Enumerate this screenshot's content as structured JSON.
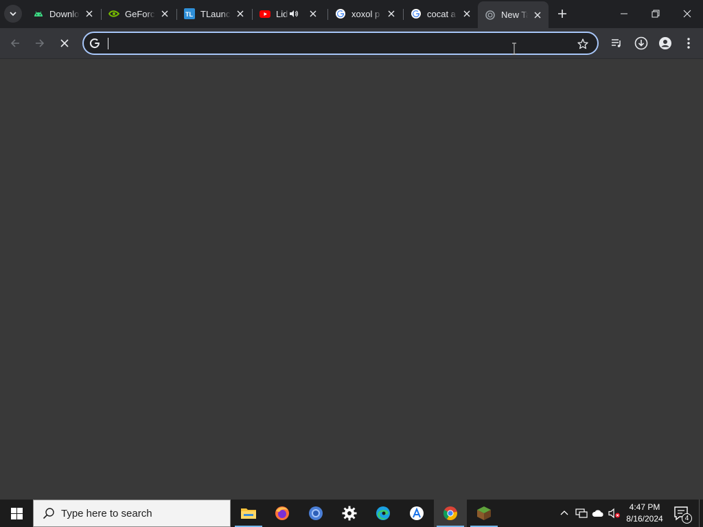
{
  "tabs": [
    {
      "title": "Download",
      "favicon": "android-icon"
    },
    {
      "title": "GeForce",
      "favicon": "nvidia-icon"
    },
    {
      "title": "TLauncher",
      "favicon": "tlauncher-icon"
    },
    {
      "title": "Lidl",
      "favicon": "youtube-icon",
      "audio": true
    },
    {
      "title": "xoxol p",
      "favicon": "google-icon"
    },
    {
      "title": "cocat a",
      "favicon": "google-icon"
    },
    {
      "title": "New Tab",
      "favicon": "loading-icon",
      "active": true
    }
  ],
  "omnibox": {
    "value": "",
    "placeholder": ""
  },
  "taskbar": {
    "search_placeholder": "Type here to search",
    "apps": [
      "file-explorer-icon",
      "firefox-icon",
      "chromium-icon",
      "settings-icon",
      "edge-icon",
      "app-store-icon",
      "chrome-icon",
      "minecraft-icon"
    ],
    "time": "4:47 PM",
    "date": "8/16/2024",
    "notification_count": "4"
  },
  "colors": {
    "accent": "#a8c7fa",
    "content_bg": "#393939",
    "toolbar_bg": "#35363a",
    "tabstrip_bg": "#202124"
  }
}
